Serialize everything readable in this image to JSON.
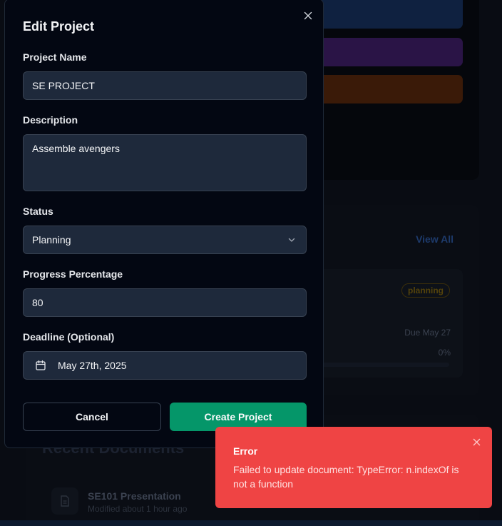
{
  "background": {
    "view_all_label": "View All",
    "project_badge": "planning",
    "project_due": "Due May 27",
    "project_progress": "0%",
    "documents_title": "Recent Documents",
    "document_name": "SE101 Presentation",
    "document_meta": "Modified about 1 hour ago"
  },
  "modal": {
    "title": "Edit Project",
    "name_label": "Project Name",
    "name_value": "SE PROJECT",
    "description_label": "Description",
    "description_value": "Assemble avengers",
    "status_label": "Status",
    "status_value": "Planning",
    "progress_label": "Progress Percentage",
    "progress_value": "80",
    "deadline_label": "Deadline (Optional)",
    "deadline_value": "May 27th, 2025",
    "cancel_label": "Cancel",
    "submit_label": "Create Project"
  },
  "toast": {
    "title": "Error",
    "message": "Failed to update document: TypeError: n.indexOf is not a function"
  },
  "colors": {
    "accent": "#059669",
    "error": "#ef4444",
    "badge_warning": "#54430b"
  },
  "icons": [
    "close-icon",
    "chevron-down-icon",
    "calendar-icon",
    "document-icon"
  ]
}
